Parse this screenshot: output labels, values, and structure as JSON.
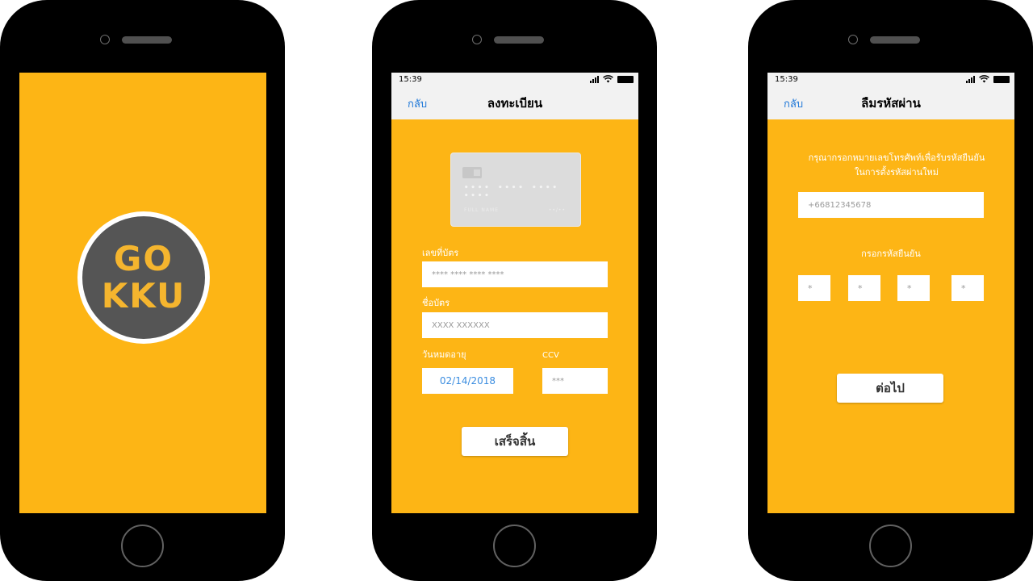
{
  "splash": {
    "logo_line1": "GO",
    "logo_line2": "KKU"
  },
  "register": {
    "status_time": "15:39",
    "back_label": "กลับ",
    "title": "ลงทะเบียน",
    "card_number_preview": "•••• •••• •••• ••••",
    "card_name_preview": "FULL NAME",
    "card_exp_preview": "••/••",
    "card_number_label": "เลขที่บัตร",
    "card_number_placeholder": "**** **** **** ****",
    "card_name_label": "ชื่อบัตร",
    "card_name_placeholder": "XXXX XXXXXX",
    "expiry_label": "วันหมดอายุ",
    "expiry_value": "02/14/2018",
    "ccv_label": "CCV",
    "ccv_placeholder": "***",
    "finish_button": "เสร็จสิ้น"
  },
  "forgot": {
    "status_time": "15:39",
    "back_label": "กลับ",
    "title": "ลืมรหัสผ่าน",
    "instruction_line1": "กรุณากรอกหมายเลขโทรศัพท์เพื่อรับรหัสยืนยัน",
    "instruction_line2": "ในการตั้งรหัสผ่านใหม่",
    "phone_placeholder": "+66812345678",
    "otp_label": "กรอกรหัสยืนยัน",
    "otp_digits": [
      "*",
      "*",
      "*",
      "*"
    ],
    "next_button": "ต่อไป"
  },
  "colors": {
    "screen_background": "#FDB515",
    "logo_text": "#F5B52E",
    "logo_circle": "#555555",
    "link_blue": "#1f78d8"
  }
}
